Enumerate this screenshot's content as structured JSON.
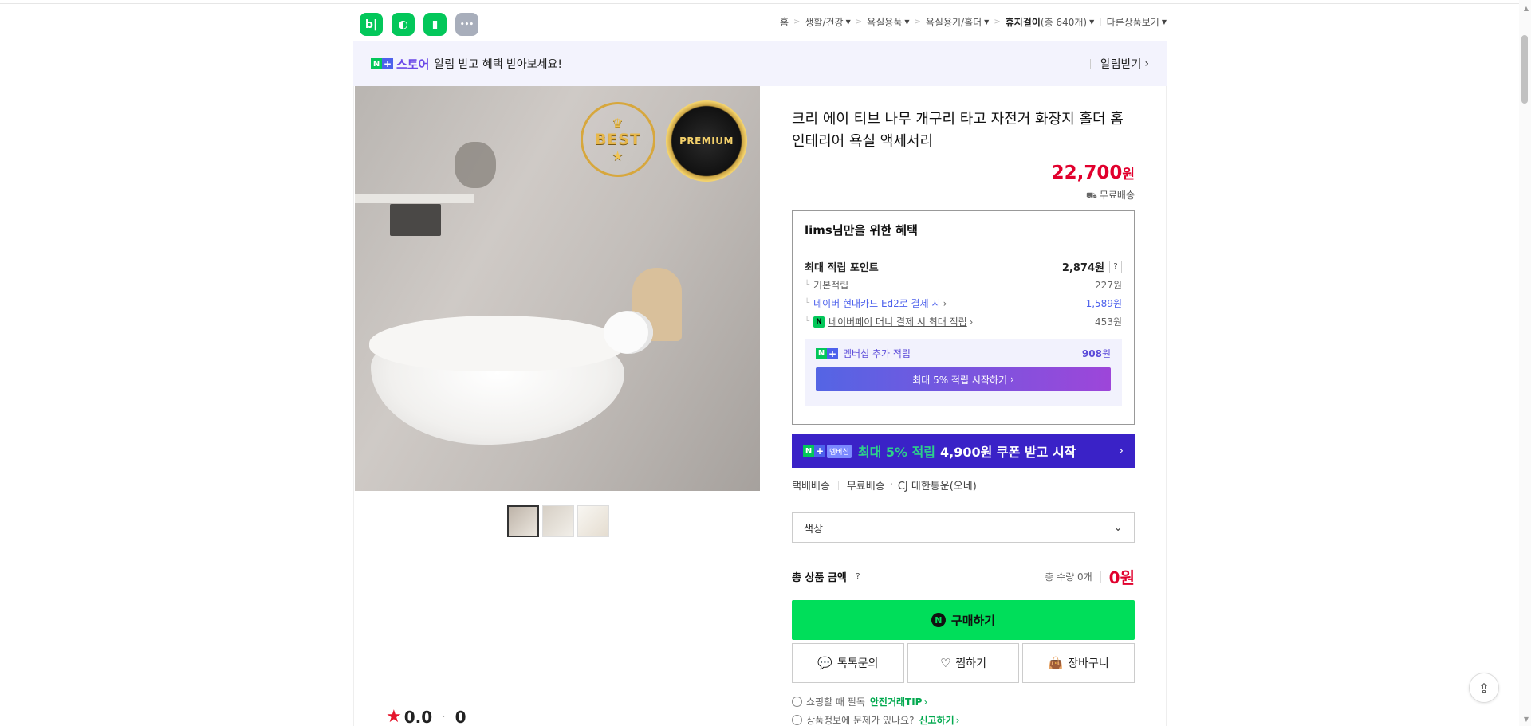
{
  "top_apps": [
    {
      "icon": "blog-icon",
      "glyph": "b|"
    },
    {
      "icon": "apple-icon",
      "glyph": "🍏"
    },
    {
      "icon": "bookmark-icon",
      "glyph": "◆"
    },
    {
      "icon": "more-icon",
      "glyph": "•••"
    }
  ],
  "breadcrumb": {
    "home": "홈",
    "cat1": "생활/건강",
    "cat2": "욕실용품",
    "cat3": "욕실용기/홀더",
    "cat4": "휴지걸이",
    "cat4_count": "(총 640개)",
    "other": "다른상품보기"
  },
  "banner": {
    "store": "스토어",
    "message": "알림 받고 혜택 받아보세요!",
    "notify": "알림받기"
  },
  "product": {
    "title": "크리 에이 티브 나무 개구리 타고 자전거 화장지 홀더 홈 인테리어 욕실 액세서리",
    "price": "22,700",
    "currency": "원",
    "shipping": "무료배송",
    "badge_best": "BEST",
    "badge_premium": "PREMIUM"
  },
  "benefit": {
    "heading": "lims님만을 위한 혜택",
    "max_points_label": "최대 적립 포인트",
    "max_points_value": "2,874원",
    "basic_label": "기본적립",
    "basic_value": "227원",
    "card_label": "네이버 현대카드 Ed2로 결제 시",
    "card_value": "1,589원",
    "pay_label": "네이버페이 머니 결제 시 최대 적립",
    "pay_value": "453원",
    "member_label": "멤버십 추가 적립",
    "member_value": "908",
    "member_unit": "원",
    "member_button": "최대 5% 적립 시작하기"
  },
  "promo": {
    "tag": "멤버십",
    "highlight": "최대 5% 적립",
    "text": "4,900원 쿠폰 받고 시작"
  },
  "delivery": {
    "type": "택배배송",
    "fee": "무료배송",
    "carrier": "CJ 대한통운(오네)"
  },
  "option": {
    "placeholder": "색상"
  },
  "total": {
    "label": "총 상품 금액",
    "qty": "총 수량 0개",
    "amount": "0원"
  },
  "actions": {
    "buy": "구매하기",
    "talk": "톡톡문의",
    "wish": "찜하기",
    "cart": "장바구니"
  },
  "tips": {
    "tip1_text": "쇼핑할 때 필독",
    "tip1_link": "안전거래TIP",
    "tip2_text": "상품정보에 문제가 있나요?",
    "tip2_link": "신고하기"
  },
  "rating": {
    "score": "0.0",
    "count": "0"
  },
  "colors": {
    "naver_green": "#03c75a",
    "price_red": "#e1002d",
    "membership_purple": "#6b48e8",
    "buy_green": "#00de5a"
  }
}
